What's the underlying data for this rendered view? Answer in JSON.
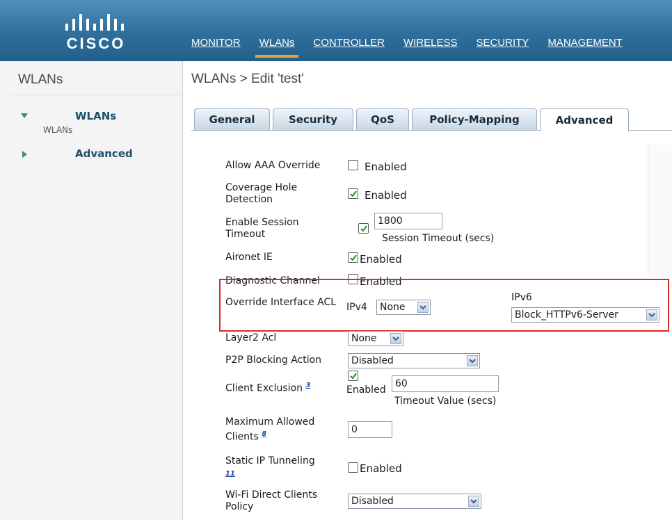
{
  "brand": {
    "logo_text": "CISCO"
  },
  "nav": [
    "MONITOR",
    "WLANs",
    "CONTROLLER",
    "WIRELESS",
    "SECURITY",
    "MANAGEMENT"
  ],
  "nav_active": "WLANs",
  "sidebar": {
    "title": "WLANs",
    "items": [
      {
        "label": "WLANs",
        "sub": "WLANs"
      },
      {
        "label": "Advanced"
      }
    ]
  },
  "breadcrumb": "WLANs > Edit  'test'",
  "tabs": [
    "General",
    "Security",
    "QoS",
    "Policy-Mapping",
    "Advanced"
  ],
  "active_tab": "Advanced",
  "form": {
    "allow_aaa_override": {
      "label": "Allow AAA Override",
      "checked": false,
      "text": "Enabled"
    },
    "coverage_hole": {
      "label": "Coverage Hole Detection",
      "checked": true,
      "text": "Enabled"
    },
    "session_timeout": {
      "label": "Enable Session Timeout",
      "checked": true,
      "value": "1800",
      "hint": "Session Timeout (secs)"
    },
    "aironet_ie": {
      "label": "Aironet IE",
      "checked": true,
      "text": "Enabled"
    },
    "diagnostic_channel": {
      "label": "Diagnostic Channel",
      "checked": false,
      "text": "Enabled"
    },
    "override_acl": {
      "label": "Override Interface ACL",
      "ipv4_label": "IPv4",
      "ipv4_value": "None",
      "ipv6_label": "IPv6",
      "ipv6_value": "Block_HTTPv6-Server"
    },
    "layer2_acl": {
      "label": "Layer2 Acl",
      "value": "None"
    },
    "p2p_blocking": {
      "label": "P2P Blocking Action",
      "value": "Disabled"
    },
    "client_exclusion": {
      "label": "Client Exclusion",
      "footnote": "3",
      "checked": true,
      "text": "Enabled",
      "value": "60",
      "hint": "Timeout Value (secs)"
    },
    "max_clients": {
      "label": "Maximum Allowed Clients",
      "footnote": "8",
      "value": "0"
    },
    "static_ip_tunneling": {
      "label": "Static IP Tunneling",
      "footnote": "11",
      "checked": false,
      "text": "Enabled"
    },
    "wifi_direct": {
      "label": "Wi-Fi Direct Clients Policy",
      "value": "Disabled"
    }
  },
  "colors": {
    "header": "#2f6f9c",
    "tab_active": "#ffffff",
    "highlight": "#d62b2b",
    "accent": "#f0a030"
  },
  "icons": {
    "checkbox_check": "check-icon",
    "dropdown": "chevron-down-icon",
    "expand": "triangle-down-icon",
    "collapse": "triangle-right-icon"
  }
}
